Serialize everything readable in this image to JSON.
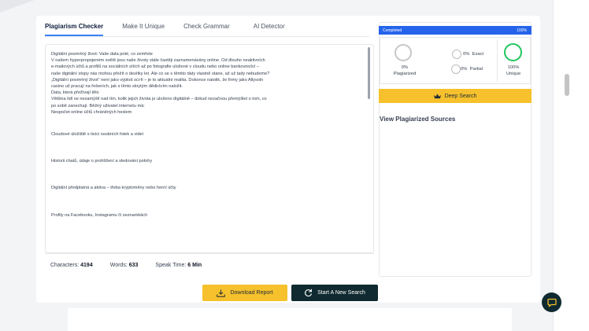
{
  "tabs": [
    {
      "label": "Plagiarism Checker",
      "active": true
    },
    {
      "label": "Make It Unique",
      "active": false
    },
    {
      "label": "Check Grammar",
      "active": false
    },
    {
      "label": "AI Detector",
      "active": false
    }
  ],
  "document": {
    "lines": [
      "Digitální posmrtný život: Vaše data poté, co zemřete",
      "V našem hyperpropojeném světě jsou naše životy stále častěji zaznamenávány online. Od dlouho neaktivních",
      "e-mailových účtů a profilů na sociálních sítích až po fotografie uložené v cloudu nebo online bankovnictví –",
      "naše digitální stopy nás mohou přežít o desítky let. Ale co se s těmito daty vlastně stane, až už tady nebudeme?",
      "„Digitální posmrtný život“ není jako výplod sci-fi – je to aktuální realita. Dokonce natolik, že firmy jako Allysoln",
      "casino už pracují na řešeních, jak s tímto skrytým dědictvím naložit.",
      "Data, která přežívají tělo",
      "Většina lidí se nezamýšlí nad tím, kolik jejich života je uloženo digitálně – dokud nezačnou přemýšlet o tom, co",
      "po sobě zanechají. Běžný uživatel internetu má:",
      "Nespočet online účtů chráněných heslem"
    ],
    "list_items": [
      "Cloudové úložiště s tisíci osobních fotek a videí",
      "Historii chatů, údaje o prohlížení a sledování polohy",
      "Digitální předplatná a aktiva – třeba kryptoměny nebo herní účty",
      "Profily na Facebooku, Instagramu či seznamkách"
    ]
  },
  "stats": {
    "characters_label": "Characters:",
    "characters_value": "4194",
    "words_label": "Words:",
    "words_value": "633",
    "speak_label": "Speak Time:",
    "speak_value": "6 Min"
  },
  "results": {
    "progress_label": "Completed",
    "progress_value": "100%",
    "plagiarized_percent": "0%",
    "plagiarized_label": "Plagiarized",
    "exact_percent": "0%",
    "exact_label": "Exact",
    "partial_percent": "0%",
    "partial_label": "Partial",
    "unique_percent": "100%",
    "unique_label": "Unique",
    "deep_search_label": "Deep Search",
    "view_sources_label": "View Plagiarized Sources"
  },
  "actions": {
    "download_label": "Download Report",
    "new_search_label": "Start A New Search"
  },
  "colors": {
    "accent_blue": "#2563eb",
    "accent_yellow": "#f6c12c",
    "dark_teal": "#0f2a30",
    "unique_green": "#22c55e"
  },
  "icons": [
    "crown-icon",
    "download-icon",
    "refresh-icon",
    "chat-icon"
  ]
}
